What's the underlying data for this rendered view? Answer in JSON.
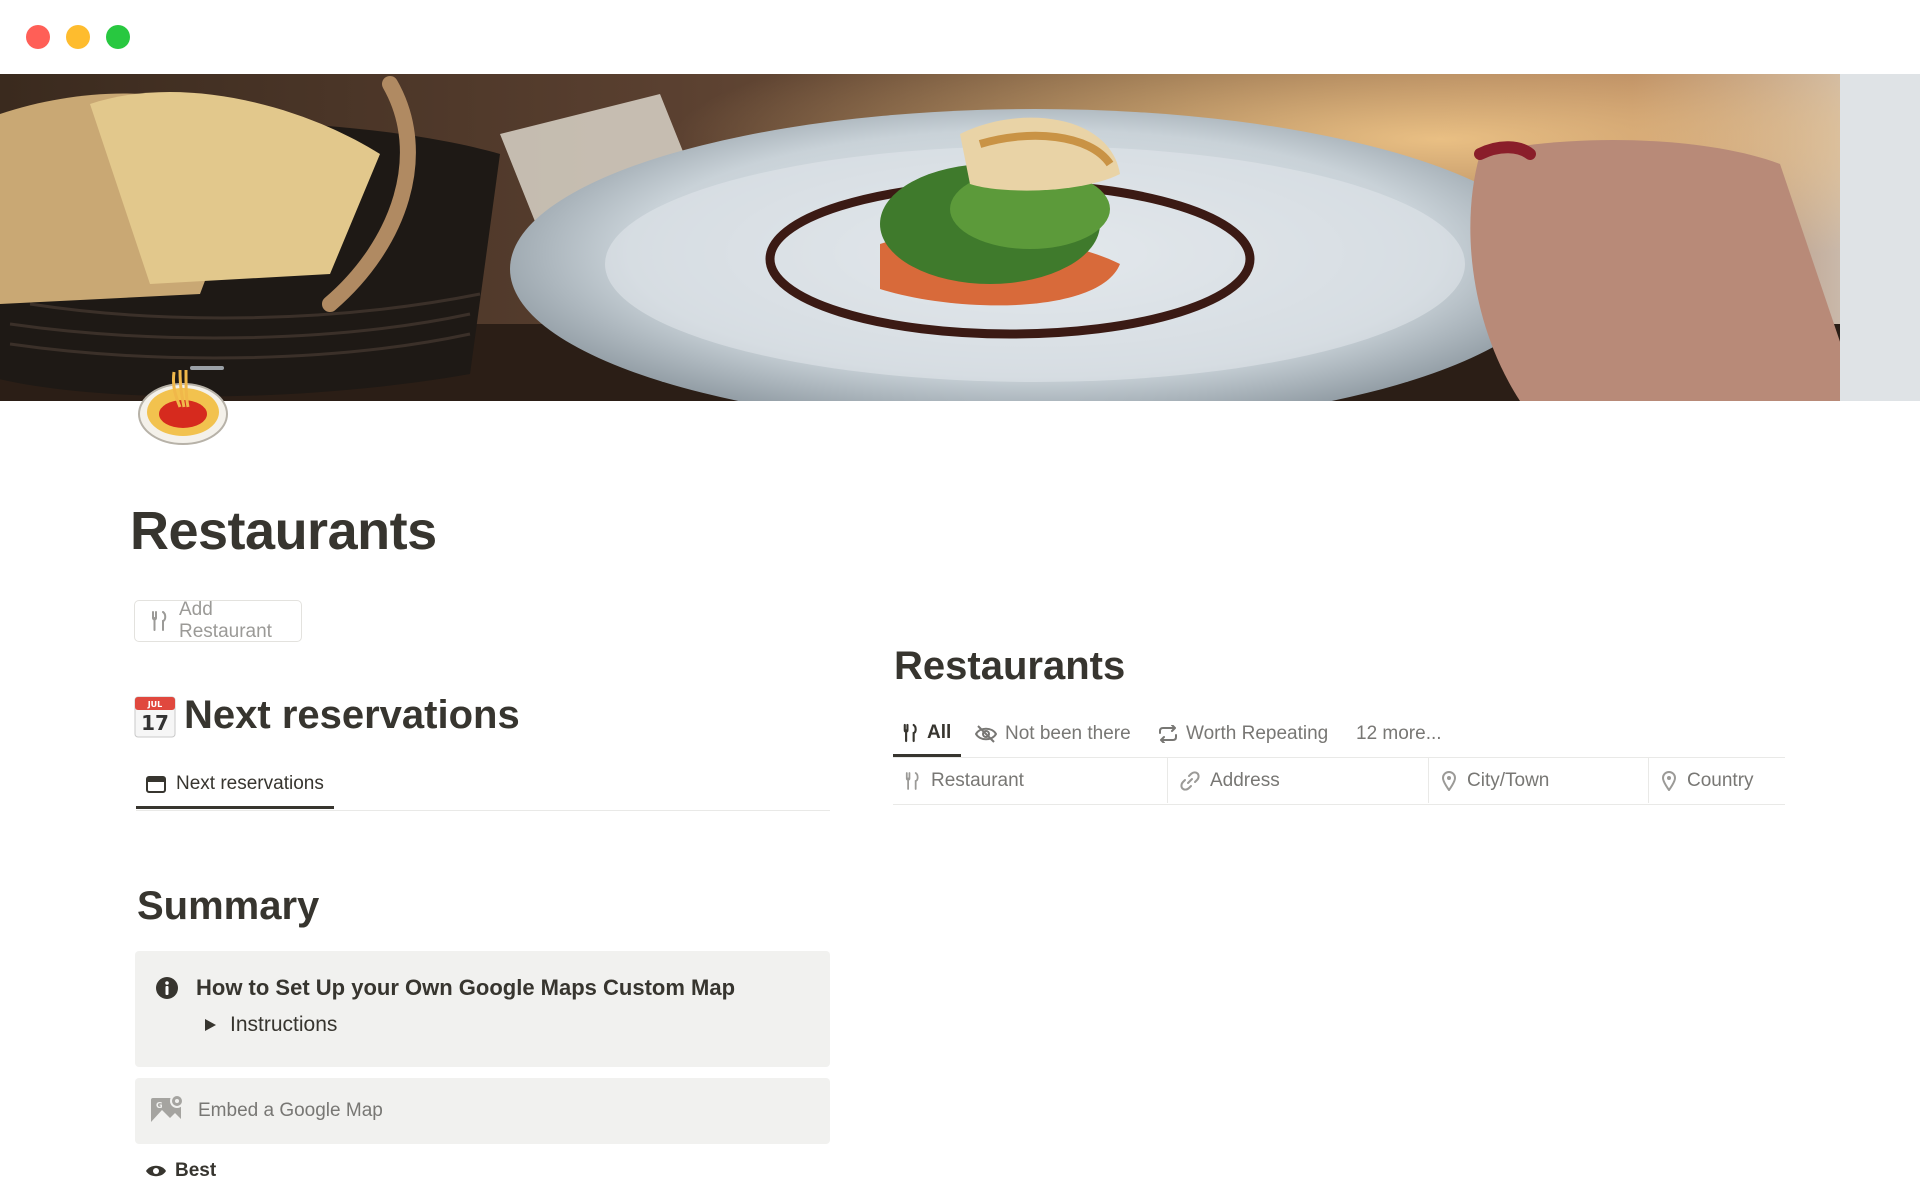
{
  "page": {
    "title": "Restaurants",
    "add_button_label": "Add Restaurant"
  },
  "next_reservations": {
    "calendar_icon": {
      "month": "JUL",
      "day": "17"
    },
    "heading": "Next reservations",
    "tab_label": "Next reservations"
  },
  "summary": {
    "heading": "Summary",
    "callout_title": "How to Set Up your Own Google Maps Custom Map",
    "toggle_label": "Instructions",
    "embed_label": "Embed a Google Map",
    "best_label": "Best"
  },
  "restaurants_db": {
    "heading": "Restaurants",
    "tabs": [
      {
        "label": "All",
        "icon": "fork-knife-icon",
        "active": true
      },
      {
        "label": "Not been there",
        "icon": "eye-slash-icon",
        "active": false
      },
      {
        "label": "Worth Repeating",
        "icon": "repeat-icon",
        "active": false
      },
      {
        "label": "12 more...",
        "icon": "",
        "active": false
      }
    ],
    "columns": [
      {
        "label": "Restaurant",
        "icon": "fork-knife-icon"
      },
      {
        "label": "Address",
        "icon": "link-icon"
      },
      {
        "label": "City/Town",
        "icon": "location-pin-icon"
      },
      {
        "label": "Country",
        "icon": "location-pin-icon"
      }
    ]
  },
  "colors": {
    "text": "#37352f",
    "muted": "#787774",
    "callout_bg": "#f1f1ef",
    "traffic_red": "#ff5f57",
    "traffic_yellow": "#febc2e",
    "traffic_green": "#28c840"
  }
}
